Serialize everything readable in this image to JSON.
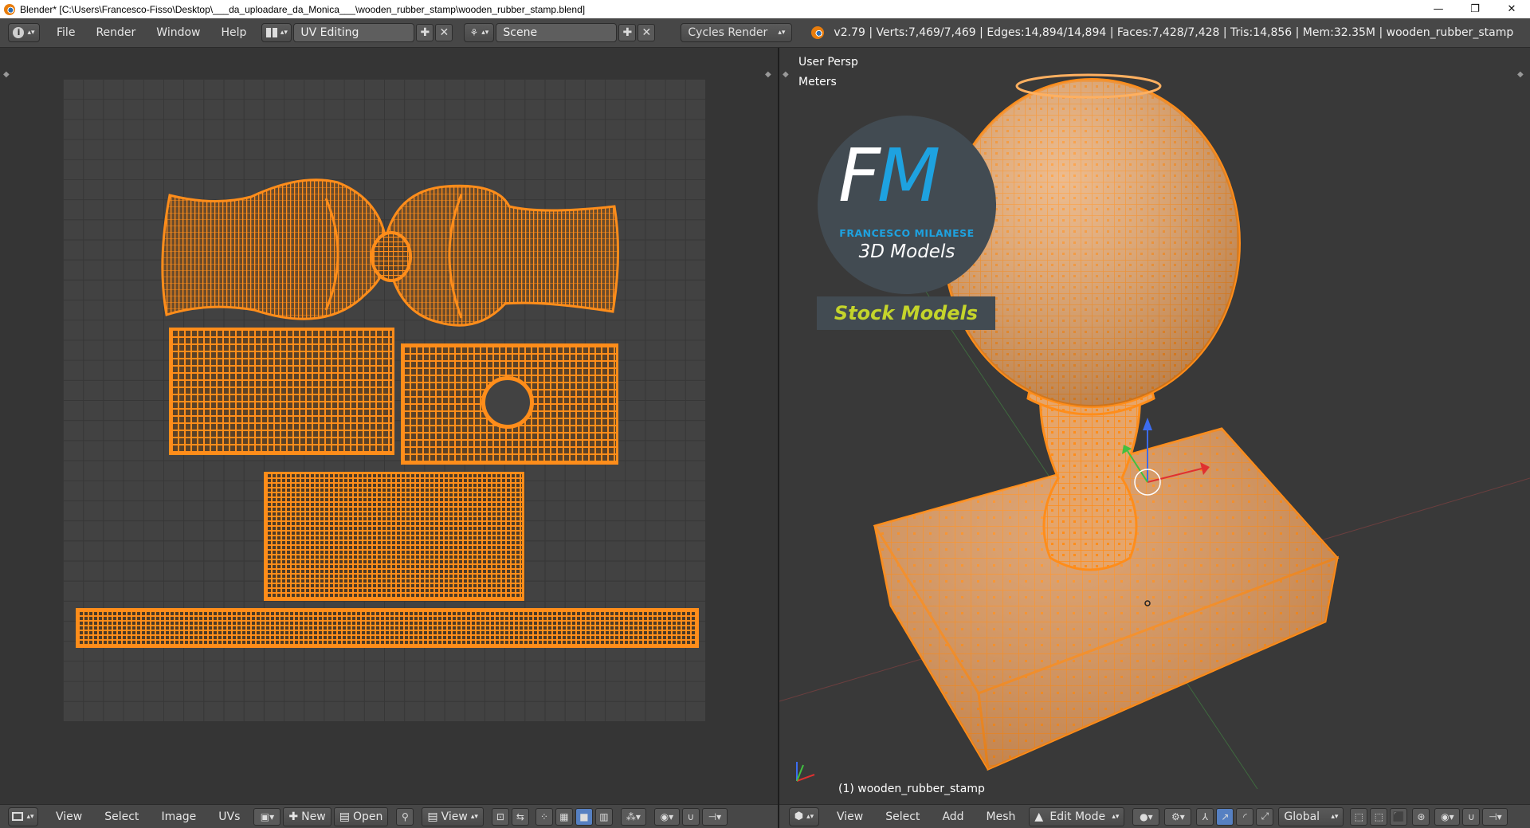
{
  "window": {
    "title": "Blender* [C:\\Users\\Francesco-Fisso\\Desktop\\___da_uploadare_da_Monica___\\wooden_rubber_stamp\\wooden_rubber_stamp.blend]",
    "minimize": "—",
    "restore": "❐",
    "close": "✕"
  },
  "info_header": {
    "menus": [
      "File",
      "Render",
      "Window",
      "Help"
    ],
    "screen_layout": "UV Editing",
    "scene": "Scene",
    "render_engine": "Cycles Render",
    "stats": "v2.79 | Verts:7,469/7,469 | Edges:14,894/14,894 | Faces:7,428/7,428 | Tris:14,856 | Mem:32.35M | wooden_rubber_stamp"
  },
  "uv_editor": {
    "footer_menus": [
      "View",
      "Select",
      "Image",
      "UVs"
    ],
    "new_label": "New",
    "open_label": "Open",
    "view_label": "View"
  },
  "viewport": {
    "view_name": "User Persp",
    "units": "Meters",
    "object_label": "(1) wooden_rubber_stamp",
    "footer_menus": [
      "View",
      "Select",
      "Add",
      "Mesh"
    ],
    "mode": "Edit Mode",
    "orientation": "Global"
  },
  "logo": {
    "letter_f": "F",
    "letter_m": "M",
    "name": "FRANCESCO MILANESE",
    "subtitle": "3D Models",
    "badge": "Stock Models"
  },
  "colors": {
    "accent_orange": "#ff8d1a",
    "logo_blue": "#1ea2e0",
    "badge_yellow": "#c4d42b"
  }
}
